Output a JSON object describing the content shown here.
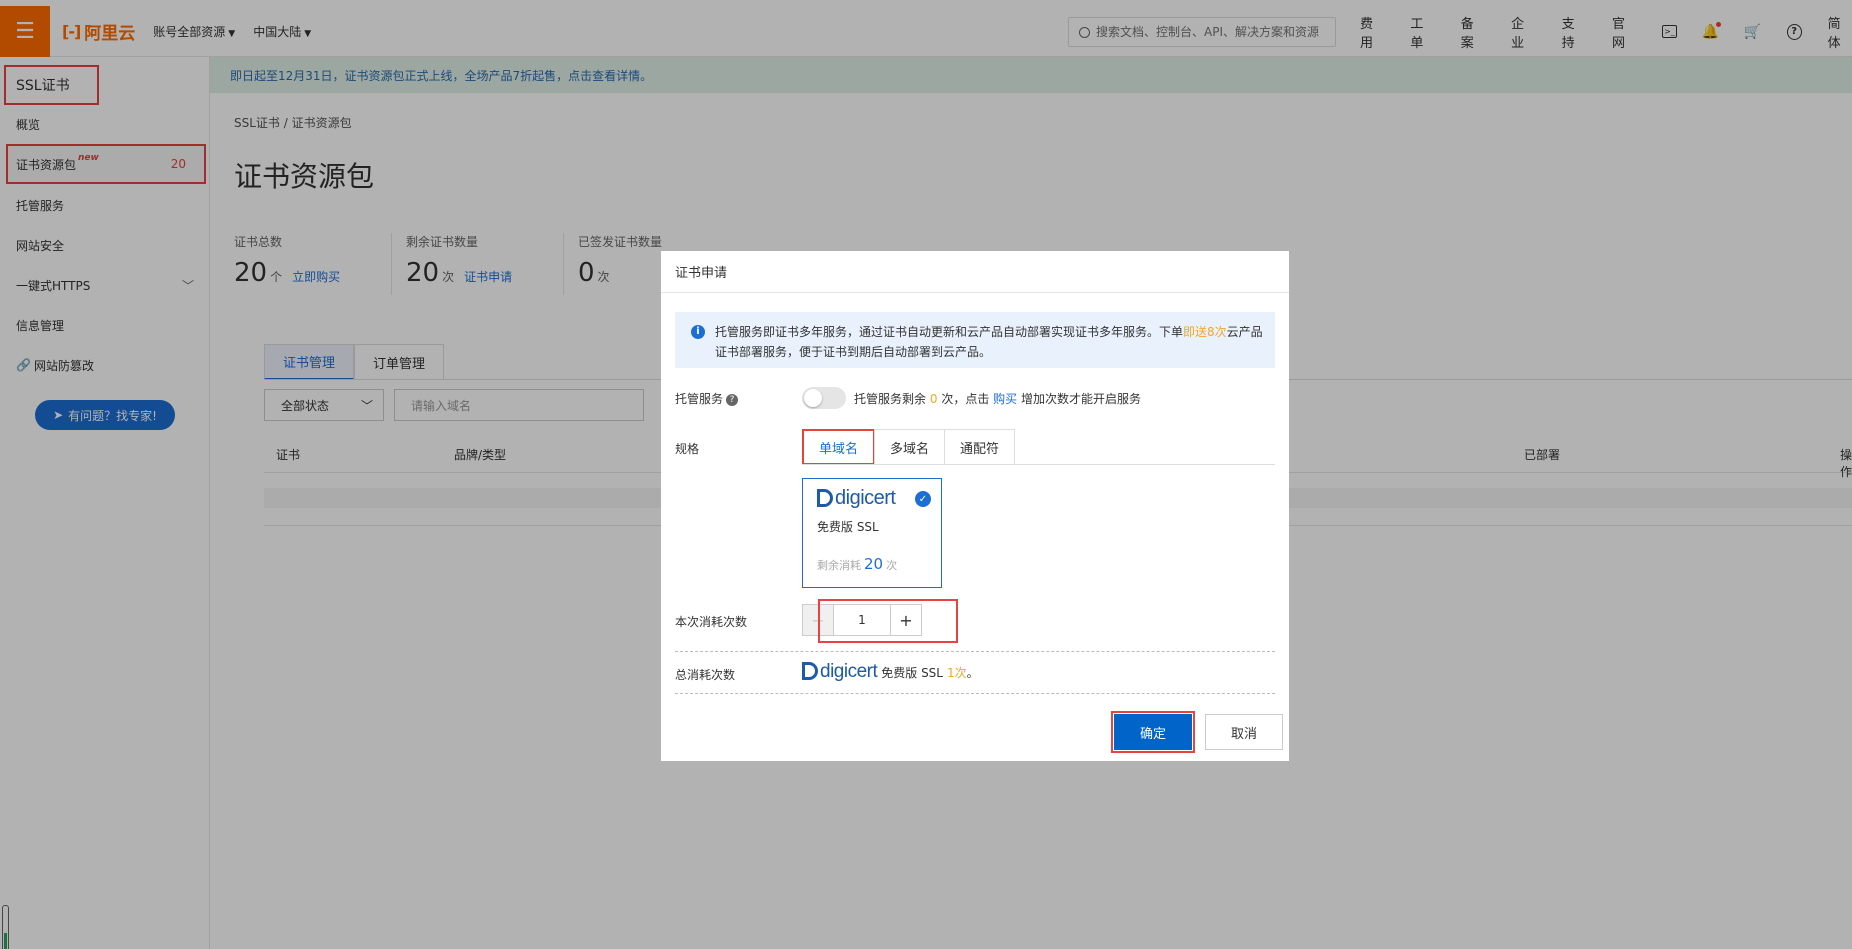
{
  "topbar": {
    "logo_text": "阿里云",
    "menu": [
      "账号全部资源",
      "中国大陆"
    ],
    "search_placeholder": "搜索文档、控制台、API、解决方案和资源",
    "right_menu": [
      "费用",
      "工单",
      "备案",
      "企业",
      "支持",
      "官网"
    ],
    "lang": "简体"
  },
  "sidebar": {
    "title": "SSL证书",
    "items": [
      {
        "label": "概览"
      },
      {
        "label": "证书资源包",
        "badge": "new",
        "count": "20"
      },
      {
        "label": "托管服务"
      },
      {
        "label": "网站安全"
      },
      {
        "label": "一键式HTTPS"
      },
      {
        "label": "信息管理"
      },
      {
        "label": "网站防篡改"
      }
    ],
    "help_button": "有问题？找专家!"
  },
  "notice": "即日起至12月31日，证书资源包正式上线，全场产品7折起售，点击查看详情。",
  "main": {
    "breadcrumb": "SSL证书  /  证书资源包",
    "title": "证书资源包",
    "stats": [
      {
        "label": "证书总数",
        "value": "20",
        "unit": "个",
        "link": "立即购买"
      },
      {
        "label": "剩余证书数量",
        "value": "20",
        "unit": "次",
        "link": "证书申请"
      },
      {
        "label": "已签发证书数量",
        "value": "0",
        "unit": "次",
        "link": ""
      }
    ],
    "tabs": [
      "证书管理",
      "订单管理"
    ],
    "filter_select": "全部状态",
    "filter_placeholder": "请输入域名",
    "columns": [
      "证书",
      "品牌/类型",
      "已部署",
      "操作"
    ]
  },
  "dialog": {
    "title": "证书申请",
    "info_part1": "托管服务即证书多年服务，通过证书自动更新和云产品自动部署实现证书多年服务。下单",
    "info_highlight": "即送8次",
    "info_part2": "云产品证书部署服务，便于证书到期后自动部署到云产品。",
    "hosting_label": "托管服务",
    "hosting_text1": "托管服务剩余",
    "hosting_count": "0",
    "hosting_text2": "次，点击",
    "hosting_link": "购买",
    "hosting_text3": "增加次数才能开启服务",
    "spec_label": "规格",
    "spec_tabs": [
      "单域名",
      "多域名",
      "通配符"
    ],
    "card_brand": "digicert",
    "card_version": "免费版 SSL",
    "card_remain_label": "剩余消耗",
    "card_remain_value": "20",
    "card_remain_unit": "次",
    "consume_label": "本次消耗次数",
    "consume_value": "1",
    "total_label": "总消耗次数",
    "total_version": "免费版 SSL",
    "total_count": "1次",
    "total_end": "。",
    "ok_label": "确定",
    "cancel_label": "取消"
  }
}
